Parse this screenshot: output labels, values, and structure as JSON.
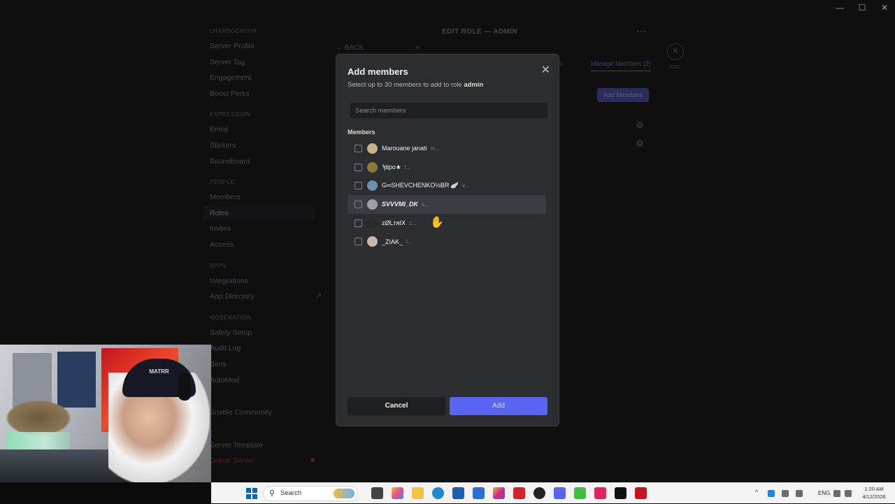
{
  "sidebar": {
    "sections": [
      {
        "title": "LHARBOCHIYIN",
        "items": [
          {
            "label": "Server Profile"
          },
          {
            "label": "Server Tag"
          },
          {
            "label": "Engagement"
          },
          {
            "label": "Boost Perks"
          }
        ]
      },
      {
        "title": "EXPRESSION",
        "items": [
          {
            "label": "Emoji"
          },
          {
            "label": "Stickers"
          },
          {
            "label": "Soundboard"
          }
        ]
      },
      {
        "title": "PEOPLE",
        "items": [
          {
            "label": "Members"
          },
          {
            "label": "Roles"
          },
          {
            "label": "Invites"
          },
          {
            "label": "Access"
          }
        ]
      },
      {
        "title": "APPS",
        "items": [
          {
            "label": "Integrations"
          },
          {
            "label": "App Directory"
          }
        ]
      },
      {
        "title": "MODERATION",
        "items": [
          {
            "label": "Safety Setup"
          },
          {
            "label": "Audit Log"
          },
          {
            "label": "Bans"
          },
          {
            "label": "AutoMod"
          }
        ]
      },
      {
        "title": "",
        "items": [
          {
            "label": "Enable Community"
          }
        ]
      },
      {
        "title": "",
        "items": [
          {
            "label": "Server Template"
          },
          {
            "label": "Delete Server"
          }
        ]
      }
    ]
  },
  "main": {
    "title": "EDIT ROLE — ADMIN",
    "back_label": "BACK",
    "plus_label": "+",
    "esc_label": "ESC",
    "manage_tab": "Manage Members (2)",
    "add_members_button": "Add Members"
  },
  "modal": {
    "title": "Add members",
    "subtitle_prefix": "Select up to 30 members to add to role ",
    "role_name": "admin",
    "search_placeholder": "Search members",
    "members_heading": "Members",
    "members": [
      {
        "name": "Marouane janati",
        "tag": "m...",
        "avatar_color": "#c8b28a"
      },
      {
        "name": "ϡtipo★",
        "tag": "f...",
        "avatar_color": "#8a7a3a"
      },
      {
        "name": "G═SHEVCHENKO½BR 🪽",
        "tag": "v...",
        "avatar_color": "#6f8fb0"
      },
      {
        "name": "SVVVMI_DK",
        "tag": "s...",
        "avatar_color": "#9aa3a8"
      },
      {
        "name": "zØLтяIX",
        "tag": "z...",
        "avatar_color": "#2a2a2a"
      },
      {
        "name": "_ZIAK_",
        "tag": "i...",
        "avatar_color": "#c9b8b0"
      }
    ],
    "cancel_label": "Cancel",
    "add_label": "Add"
  },
  "webcam": {
    "cap_text": "MATRR"
  },
  "taskbar": {
    "search_label": "Search",
    "language": "ENG",
    "time": "1:20 AM",
    "date": "4/12/2026"
  }
}
